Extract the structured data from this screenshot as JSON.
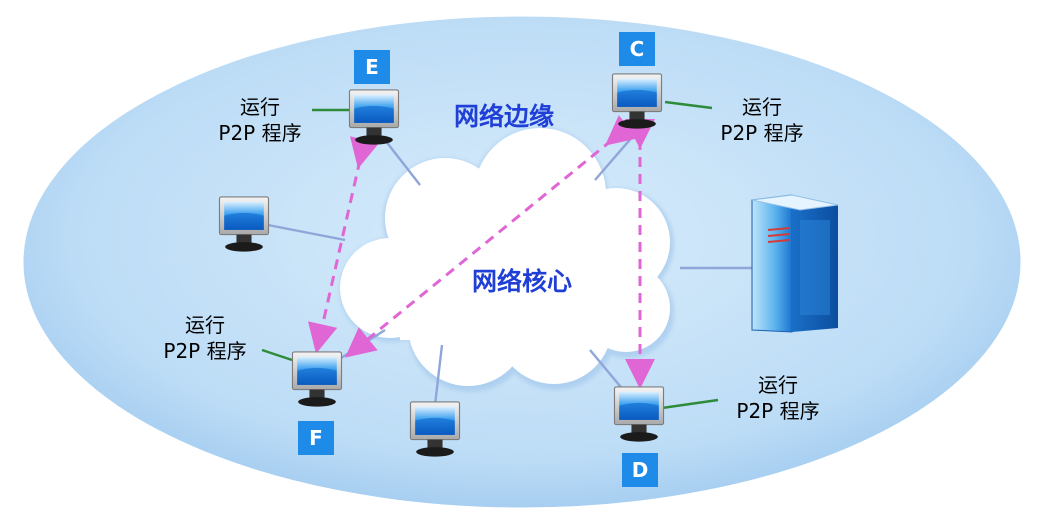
{
  "diagram": {
    "edge_label": "网络边缘",
    "core_label": "网络核心",
    "peers": [
      {
        "id": "E",
        "run_line1": "运行",
        "run_line2": "P2P 程序"
      },
      {
        "id": "C",
        "run_line1": "运行",
        "run_line2": "P2P 程序"
      },
      {
        "id": "F",
        "run_line1": "运行",
        "run_line2": "P2P 程序"
      },
      {
        "id": "D",
        "run_line1": "运行",
        "run_line2": "P2P 程序"
      }
    ]
  },
  "colors": {
    "edge_ellipse": "#bcdcf6",
    "cloud": "#ffffff",
    "link_line": "#8fa6d8",
    "callout_line": "#2e8b3a",
    "p2p_arrow": "#e066d6",
    "badge": "#1e8be8",
    "title_text": "#1f3fd6"
  }
}
